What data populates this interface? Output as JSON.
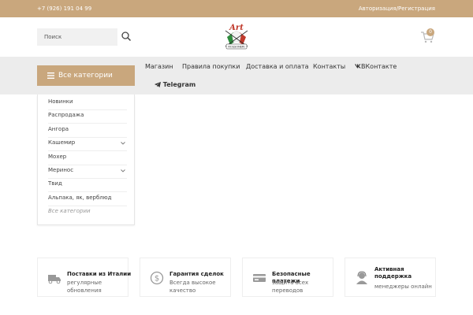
{
  "topbar": {
    "phone": "+7 (926) 191 04 99",
    "auth": "Авторизация/Регистрация"
  },
  "header": {
    "search_placeholder": "Поиск",
    "logo_text": "Art",
    "logo_sub": "ROSSONERI",
    "cart_count": "0"
  },
  "navbar": {
    "categories_label": "Все категории",
    "links": [
      "Магазин",
      "Правила покупки",
      "Доставка и оплата",
      "Контакты",
      "ВКонтакте",
      "Telegram"
    ]
  },
  "categories": {
    "items": [
      "Новинки",
      "Распродажа",
      "Ангора",
      "Кашемир",
      "Мохер",
      "Меринос",
      "Твид",
      "Альпака, як, верблюд"
    ],
    "all_label": "Все категории"
  },
  "features": [
    {
      "title": "Поставки из Италии",
      "subtitle": "регулярные обновления",
      "icon": "truck-icon"
    },
    {
      "title": "Гарантия сделок",
      "subtitle": "Всегда высокое качество",
      "icon": "dollar-icon"
    },
    {
      "title": "Безопасные платежи",
      "subtitle": "защита всех переводов",
      "icon": "card-icon"
    },
    {
      "title": "Активная поддержка",
      "subtitle": "менеджеры онлайн",
      "icon": "support-icon"
    }
  ],
  "colors": {
    "accent": "#c9a77d",
    "nav_bg": "#ececec"
  }
}
